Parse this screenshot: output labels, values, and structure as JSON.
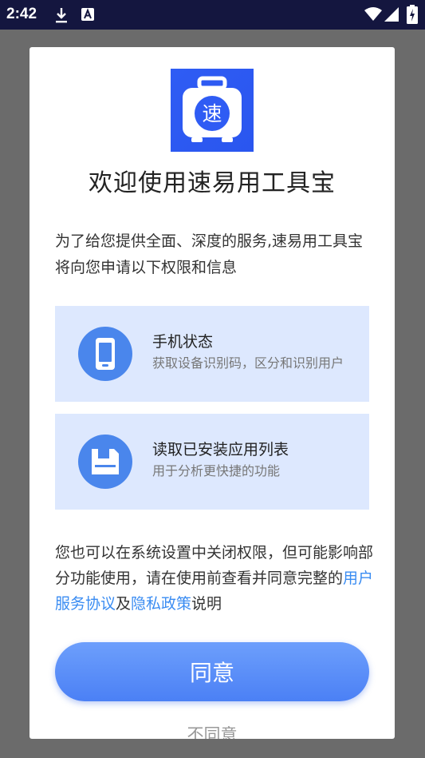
{
  "status_bar": {
    "time": "2:42",
    "icons": [
      "download-icon",
      "a-icon",
      "wifi-icon",
      "signal-icon",
      "battery-icon"
    ]
  },
  "dialog": {
    "app_icon_char": "速",
    "title": "欢迎使用速易用工具宝",
    "intro": "为了给您提供全面、深度的服务,速易用工具宝将向您申请以下权限和信息",
    "permissions": [
      {
        "icon": "phone-icon",
        "title": "手机状态",
        "desc": "获取设备识别码，区分和识别用户"
      },
      {
        "icon": "app-list-icon",
        "title": "读取已安装应用列表",
        "desc": "用于分析更快捷的功能"
      }
    ],
    "notice": {
      "prefix": "您也可以在系统设置中关闭权限，但可能影响部分功能使用，请在使用前查看并同意完整的",
      "link1": "用户服务协议",
      "mid": "及",
      "link2": "隐私政策",
      "suffix": "说明"
    },
    "agree_label": "同意",
    "disagree_label": "不同意"
  },
  "colors": {
    "accent": "#4b80f5",
    "link": "#3a8cf2",
    "permission_bg": "#dde8fe",
    "status_bar": "#14163f"
  }
}
